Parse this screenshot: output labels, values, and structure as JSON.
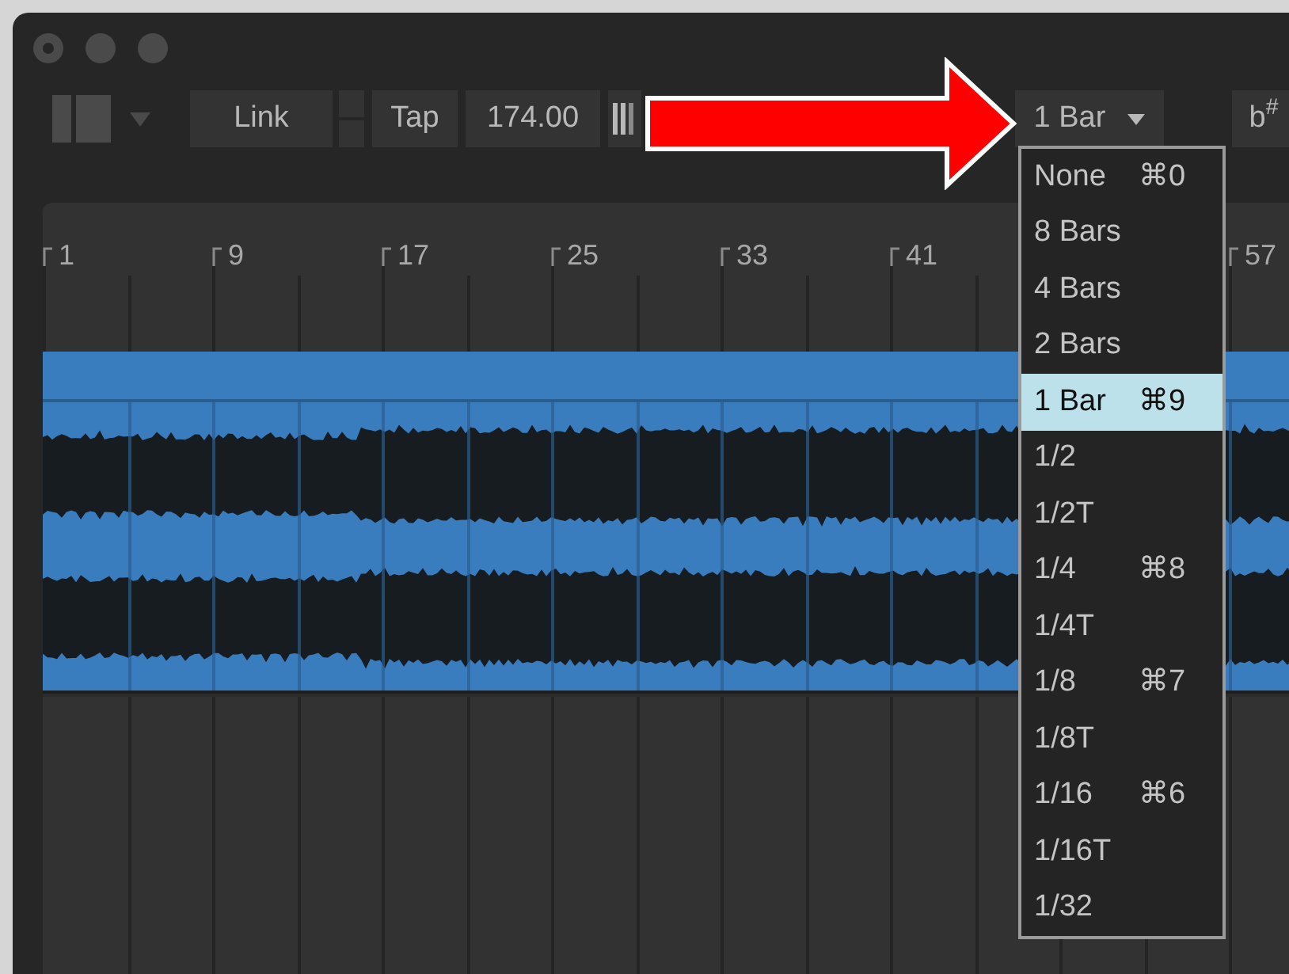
{
  "window": {
    "controls": [
      {
        "kind": "close"
      },
      {
        "kind": "minimize"
      },
      {
        "kind": "zoom"
      }
    ]
  },
  "toolbar": {
    "link": "Link",
    "tap": "Tap",
    "tempo": "174.00",
    "quantize": "1 Bar",
    "scale": "b$^{#}$"
  },
  "ruler": {
    "markers": [
      "1",
      "9",
      "17",
      "25",
      "33",
      "41",
      "57"
    ]
  },
  "quantize_menu": {
    "items": [
      {
        "label": "None",
        "shortcut": "⌘0",
        "selected": false
      },
      {
        "label": "8 Bars",
        "selected": false
      },
      {
        "label": "4 Bars",
        "selected": false
      },
      {
        "label": "2 Bars",
        "selected": false
      },
      {
        "label": "1 Bar",
        "shortcut": "⌘9",
        "selected": true
      },
      {
        "label": "1/2",
        "selected": false
      },
      {
        "label": "1/2T",
        "selected": false
      },
      {
        "label": "1/4",
        "shortcut": "⌘8",
        "selected": false
      },
      {
        "label": "1/4T",
        "selected": false
      },
      {
        "label": "1/8",
        "shortcut": "⌘7",
        "selected": false
      },
      {
        "label": "1/8T",
        "selected": false
      },
      {
        "label": "1/16",
        "shortcut": "⌘6",
        "selected": false
      },
      {
        "label": "1/16T",
        "selected": false
      },
      {
        "label": "1/32",
        "selected": false
      }
    ]
  }
}
